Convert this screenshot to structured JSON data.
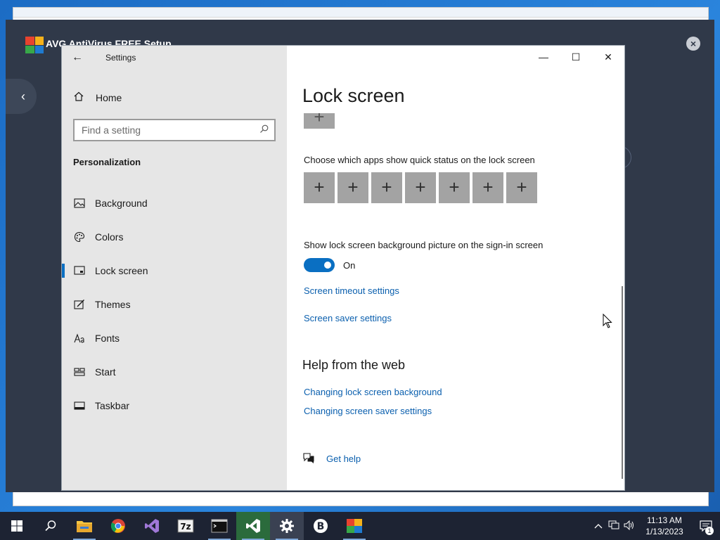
{
  "background_app": {
    "title": "AVG AntiVirus FREE Setup",
    "close_glyph": "×",
    "back_glyph": "‹"
  },
  "settings": {
    "app_title": "Settings",
    "back_glyph": "←",
    "home_label": "Home",
    "search_placeholder": "Find a setting",
    "section_title": "Personalization",
    "nav_items": [
      {
        "label": "Background",
        "icon": "picture-icon",
        "active": false
      },
      {
        "label": "Colors",
        "icon": "palette-icon",
        "active": false
      },
      {
        "label": "Lock screen",
        "icon": "lock-screen-icon",
        "active": true
      },
      {
        "label": "Themes",
        "icon": "themes-icon",
        "active": false
      },
      {
        "label": "Fonts",
        "icon": "fonts-icon",
        "active": false
      },
      {
        "label": "Start",
        "icon": "start-icon",
        "active": false
      },
      {
        "label": "Taskbar",
        "icon": "taskbar-icon",
        "active": false
      }
    ],
    "window_controls": {
      "minimize": "—",
      "maximize": "☐",
      "close": "✕"
    }
  },
  "main": {
    "page_title": "Lock screen",
    "quick_status_label": "Choose which apps show quick status on the lock screen",
    "tile_glyph": "+",
    "quick_status_tiles": 7,
    "signin_label": "Show lock screen background picture on the sign-in screen",
    "toggle_state": "On",
    "screen_timeout_link": "Screen timeout settings",
    "screen_saver_link": "Screen saver settings",
    "help_title": "Help from the web",
    "help_links": [
      "Changing lock screen background",
      "Changing screen saver settings"
    ],
    "get_help": "Get help"
  },
  "taskbar": {
    "apps": [
      "start-icon",
      "search-icon",
      "file-explorer-icon",
      "chrome-icon",
      "visual-studio-icon",
      "7zip-icon",
      "terminal-icon",
      "visual-studio-active-icon",
      "settings-icon",
      "b-app-icon",
      "avg-icon"
    ],
    "time": "11:13 AM",
    "date": "1/13/2023",
    "notification_count": "1"
  },
  "colors": {
    "accent": "#0a6fc2",
    "link": "#0a5fae",
    "sidebar_bg": "#e6e6e6",
    "tile_bg": "#a3a3a3",
    "taskbar_bg": "#1d2333",
    "avg_bg": "#303949"
  }
}
